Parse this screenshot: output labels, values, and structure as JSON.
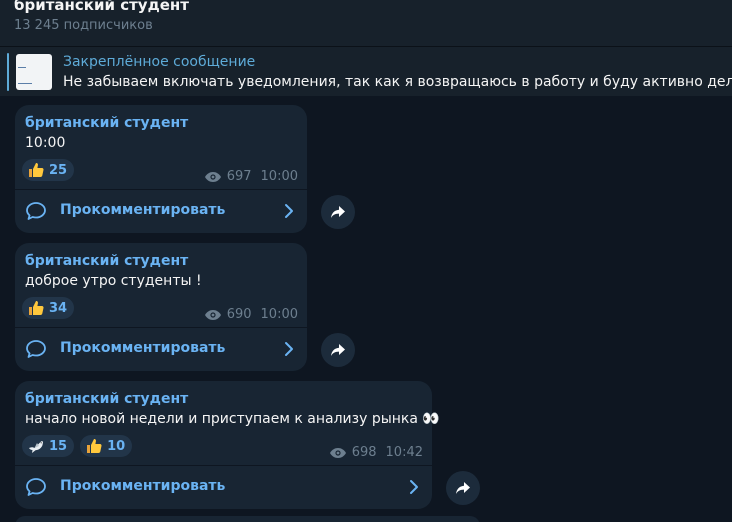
{
  "channel": {
    "title": "британский студент",
    "subscribers": "13 245 подписчиков"
  },
  "pinned": {
    "label": "Закреплённое сообщение",
    "text": "Не забываем включать уведомления, так как я возвращаюсь в работу и буду активно делиться"
  },
  "posts": [
    {
      "author": "британский студент",
      "text": "10:00",
      "reactions": [
        {
          "emoji": "thumbs-up-icon",
          "count": "25"
        }
      ],
      "views": "697",
      "time": "10:00",
      "comment_label": "Прокомментировать"
    },
    {
      "author": "британский студент",
      "text": "доброе утро студенты !",
      "reactions": [
        {
          "emoji": "thumbs-up-icon",
          "count": "34"
        }
      ],
      "views": "690",
      "time": "10:00",
      "comment_label": "Прокомментировать"
    },
    {
      "author": "британский студент",
      "text": "начало новой недели и приступаем к анализу рынка 👀",
      "reactions": [
        {
          "emoji": "dove-icon",
          "count": "15"
        },
        {
          "emoji": "thumbs-up-icon",
          "count": "10"
        }
      ],
      "views": "698",
      "time": "10:42",
      "comment_label": "Прокомментировать"
    }
  ],
  "colors": {
    "background": "#0e1621",
    "bubble": "#182533",
    "accent": "#6ab3f3",
    "muted": "#6d7f8f"
  }
}
